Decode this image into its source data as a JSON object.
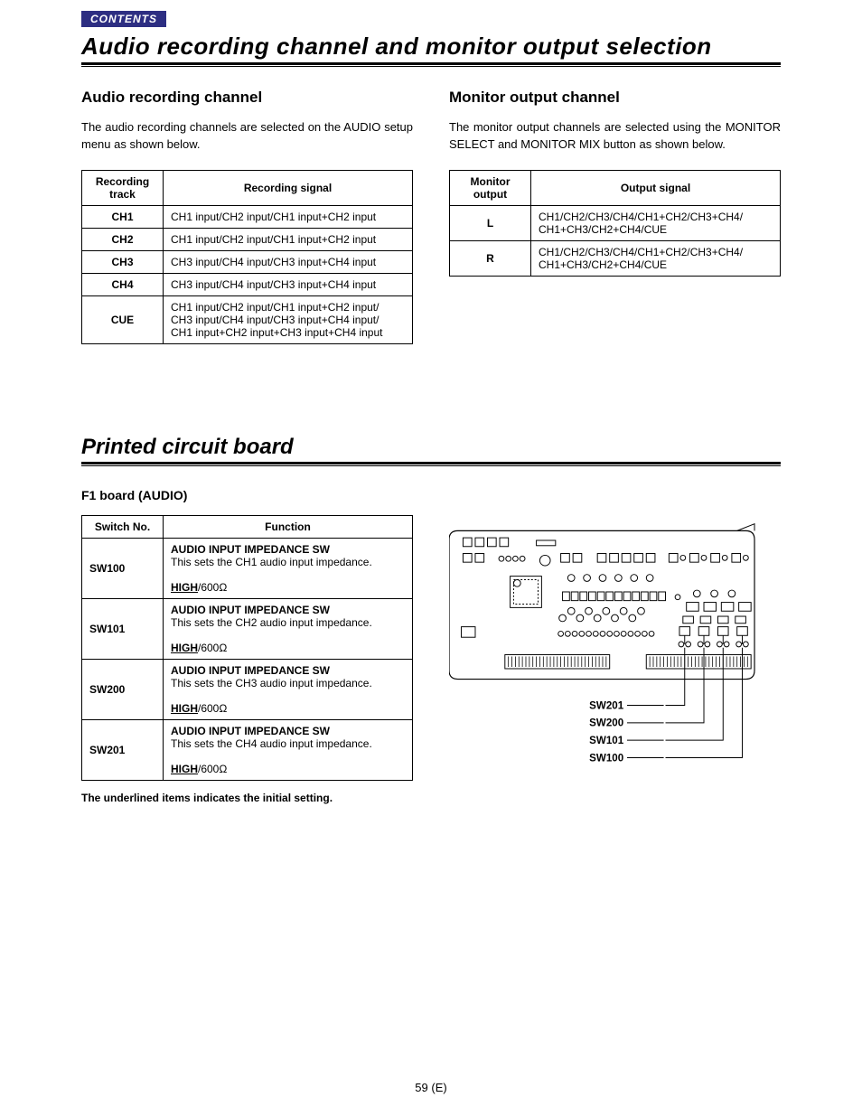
{
  "tab_label": "CONTENTS",
  "title1": "Audio recording channel and monitor output selection",
  "left": {
    "heading": "Audio recording channel",
    "paragraph": "The audio recording channels are selected on the AUDIO setup menu as shown below.",
    "table_headers": [
      "Recording track",
      "Recording signal"
    ],
    "rows": [
      {
        "track": "CH1",
        "signal": "CH1 input/CH2 input/CH1 input+CH2 input"
      },
      {
        "track": "CH2",
        "signal": "CH1 input/CH2 input/CH1 input+CH2 input"
      },
      {
        "track": "CH3",
        "signal": "CH3 input/CH4 input/CH3 input+CH4 input"
      },
      {
        "track": "CH4",
        "signal": "CH3 input/CH4 input/CH3  input+CH4 input"
      },
      {
        "track": "CUE",
        "signal": "CH1 input/CH2 input/CH1 input+CH2 input/\nCH3 input/CH4 input/CH3 input+CH4 input/\nCH1 input+CH2 input+CH3 input+CH4 input"
      }
    ]
  },
  "right": {
    "heading": "Monitor output channel",
    "paragraph": "The monitor output channels are selected using the MONITOR SELECT and MONITOR MIX button as shown below.",
    "table_headers": [
      "Monitor output",
      "Output signal"
    ],
    "rows": [
      {
        "out": "L",
        "signal": "CH1/CH2/CH3/CH4/CH1+CH2/CH3+CH4/\nCH1+CH3/CH2+CH4/CUE"
      },
      {
        "out": "R",
        "signal": "CH1/CH2/CH3/CH4/CH1+CH2/CH3+CH4/\nCH1+CH3/CH2+CH4/CUE"
      }
    ]
  },
  "title2": "Printed circuit board",
  "f1_heading": "F1 board (AUDIO)",
  "switch_headers": [
    "Switch No.",
    "Function"
  ],
  "switches": [
    {
      "no": "SW100",
      "title": "AUDIO INPUT IMPEDANCE SW",
      "desc": "This sets the CH1 audio input impedance.",
      "setting_u": "HIGH",
      "setting_rest": "/600Ω"
    },
    {
      "no": "SW101",
      "title": "AUDIO INPUT IMPEDANCE SW",
      "desc": "This sets the CH2 audio input impedance.",
      "setting_u": "HIGH",
      "setting_rest": "/600Ω"
    },
    {
      "no": "SW200",
      "title": "AUDIO INPUT IMPEDANCE SW",
      "desc": "This sets the CH3 audio input impedance.",
      "setting_u": "HIGH",
      "setting_rest": "/600Ω"
    },
    {
      "no": "SW201",
      "title": "AUDIO INPUT IMPEDANCE SW",
      "desc": "This sets the CH4 audio input impedance.",
      "setting_u": "HIGH",
      "setting_rest": "/600Ω"
    }
  ],
  "note": "The underlined items indicates the initial setting.",
  "board_labels": [
    "SW201",
    "SW200",
    "SW101",
    "SW100"
  ],
  "page_number": "59 (E)"
}
